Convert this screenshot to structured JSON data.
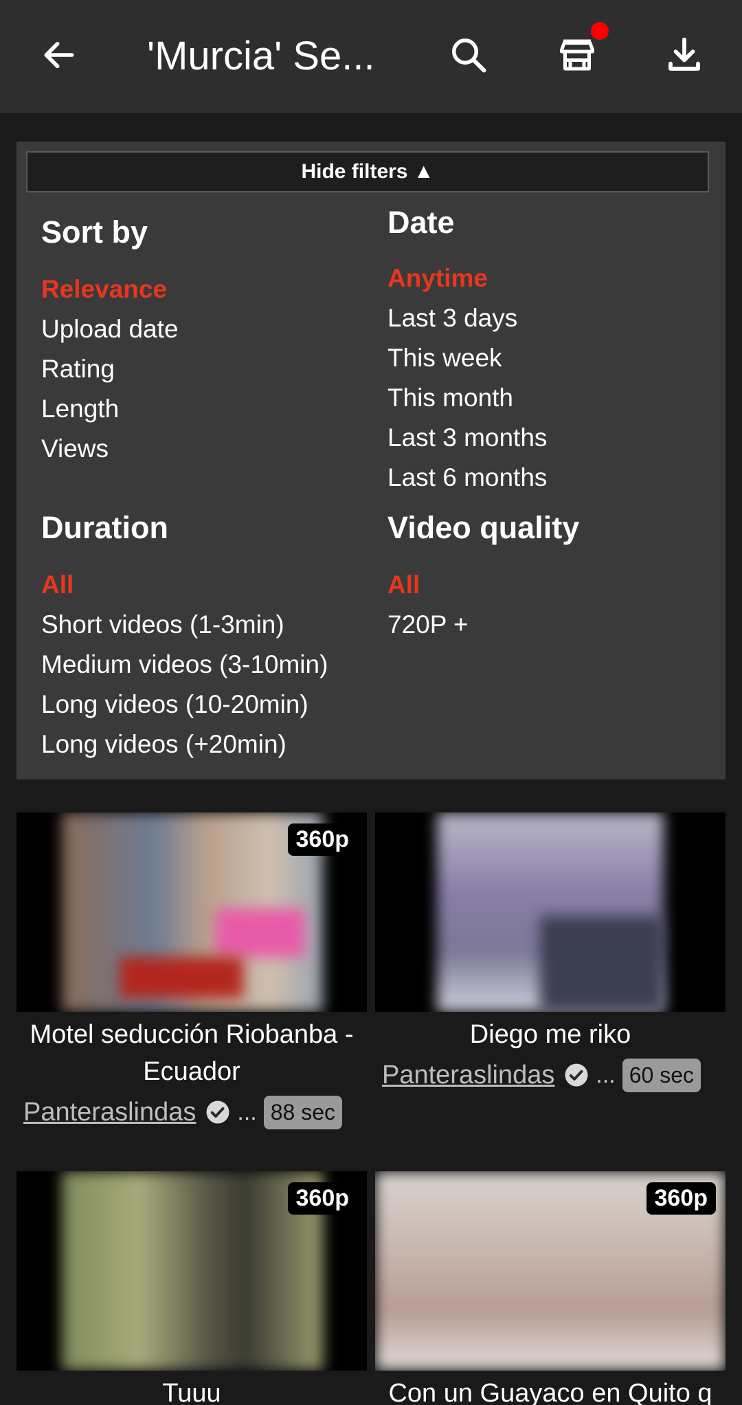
{
  "appbar": {
    "title": "'Murcia' Se...",
    "icons": [
      "back-arrow-icon",
      "search-icon",
      "store-icon",
      "download-icon"
    ],
    "notification_dot_color": "#ff0000"
  },
  "filters": {
    "toggle_label": "Hide filters ▲",
    "sort_by": {
      "heading": "Sort by",
      "options": [
        "Relevance",
        "Upload date",
        "Rating",
        "Length",
        "Views"
      ],
      "selected": "Relevance"
    },
    "date": {
      "heading": "Date",
      "options": [
        "Anytime",
        "Last 3 days",
        "This week",
        "This month",
        "Last 3 months",
        "Last 6 months"
      ],
      "selected": "Anytime"
    },
    "duration": {
      "heading": "Duration",
      "options": [
        "All",
        "Short videos (1-3min)",
        "Medium videos (3-10min)",
        "Long videos (10-20min)",
        "Long videos (+20min)"
      ],
      "selected": "All"
    },
    "quality": {
      "heading": "Video quality",
      "options": [
        "All",
        "720P +"
      ],
      "selected": "All"
    },
    "active_color": "#e8361e"
  },
  "videos": [
    {
      "quality": "360p",
      "title": "Motel seducción Riobanba -Ecuador",
      "channel": "Panteraslindas",
      "ellipsis": "...",
      "duration": "88 sec"
    },
    {
      "quality": "",
      "title": "Diego me riko",
      "channel": "Panteraslindas",
      "ellipsis": "...",
      "duration": "60 sec"
    },
    {
      "quality": "360p",
      "title": "Tuuu",
      "channel": "",
      "ellipsis": "",
      "duration": ""
    },
    {
      "quality": "360p",
      "title": "Con un Guayaco en Quito q",
      "channel": "",
      "ellipsis": "",
      "duration": ""
    }
  ]
}
